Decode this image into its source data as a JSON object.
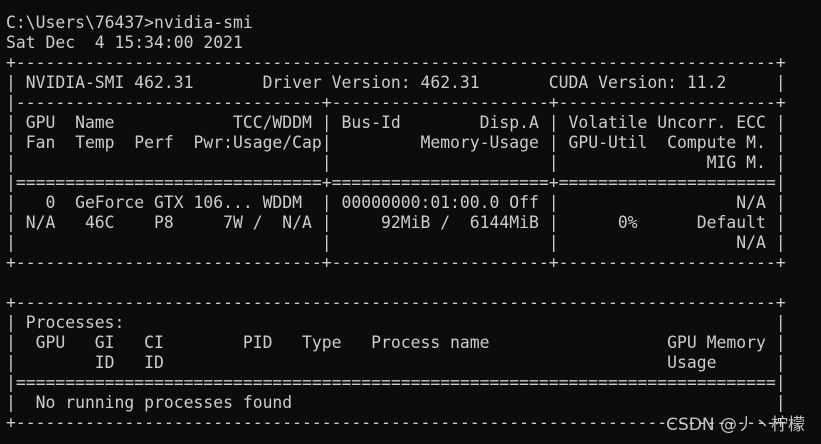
{
  "terminal": {
    "lines": [
      "C:\\Users\\76437>nvidia-smi",
      "Sat Dec  4 15:34:00 2021",
      "+-----------------------------------------------------------------------------+",
      "| NVIDIA-SMI 462.31       Driver Version: 462.31       CUDA Version: 11.2     |",
      "|-------------------------------+----------------------+----------------------+",
      "| GPU  Name            TCC/WDDM | Bus-Id        Disp.A | Volatile Uncorr. ECC |",
      "| Fan  Temp  Perf  Pwr:Usage/Cap|         Memory-Usage | GPU-Util  Compute M. |",
      "|                               |                      |               MIG M. |",
      "|===============================+======================+======================|",
      "|   0  GeForce GTX 106... WDDM  | 00000000:01:00.0 Off |                  N/A |",
      "| N/A   46C    P8     7W /  N/A |     92MiB /  6144MiB |      0%      Default |",
      "|                               |                      |                  N/A |",
      "+-------------------------------+----------------------+----------------------+",
      "",
      "+-----------------------------------------------------------------------------+",
      "| Processes:                                                                  |",
      "|  GPU   GI   CI        PID   Type   Process name                  GPU Memory |",
      "|        ID   ID                                                   Usage      |",
      "|=============================================================================|",
      "|  No running processes found                                                 |",
      "+-----------------------------------------------------------------------------+"
    ]
  },
  "watermark": {
    "text": "CSDN @丿丶柠檬"
  }
}
